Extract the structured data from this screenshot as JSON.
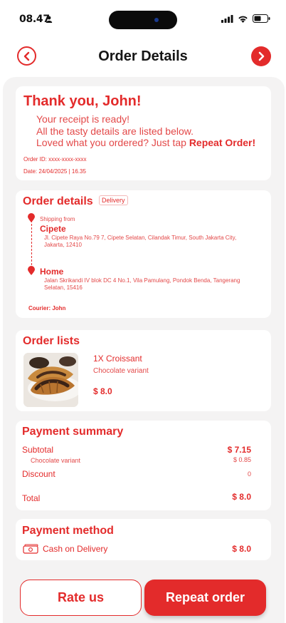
{
  "status_bar": {
    "time": "08.47"
  },
  "header": {
    "title": "Order Details"
  },
  "thanks": {
    "title": "Thank you, John!",
    "line1": "Your receipt is ready!",
    "line2": "All the tasty details are listed below.",
    "line3_prefix": "Loved what you ordered? Just tap ",
    "line3_bold": "Repeat Order!",
    "order_id": "Order ID: xxxx-xxxx-xxxx",
    "date": "Date: 24/04/2025 | 16.35"
  },
  "order_details": {
    "title": "Order details",
    "badge": "Delivery",
    "shipping_from_label": "Shipping from",
    "origin_name": "Cipete",
    "origin_address": "Jl. Cipete Raya No.79 7, Cipete Selatan, Cilandak Timur, South Jakarta City, Jakarta, 12410",
    "destination_name": "Home",
    "destination_address": "Jalan Skrikandi IV blok DC 4 No.1, Vila Pamulang, Pondok Benda, Tangerang Selatan, 15416",
    "courier": "Courier: John"
  },
  "order_lists": {
    "title": "Order lists",
    "item_name": "1X Croissant",
    "item_variant": "Chocolate variant",
    "item_price": "$ 8.0"
  },
  "payment_summary": {
    "title": "Payment summary",
    "subtotal_label": "Subtotal",
    "subtotal_value": "$ 7.15",
    "variant_label": "Chocolate variant",
    "variant_value": "$ 0.85",
    "discount_label": "Discount",
    "discount_value": "0",
    "total_label": "Total",
    "total_value": "$ 8.0"
  },
  "payment_method": {
    "title": "Payment method",
    "method": "Cash on Delivery",
    "amount": "$ 8.0"
  },
  "actions": {
    "rate_label": "Rate us",
    "repeat_label": "Repeat order"
  },
  "colors": {
    "accent": "#e32b2b",
    "background": "#f4f3f3"
  }
}
